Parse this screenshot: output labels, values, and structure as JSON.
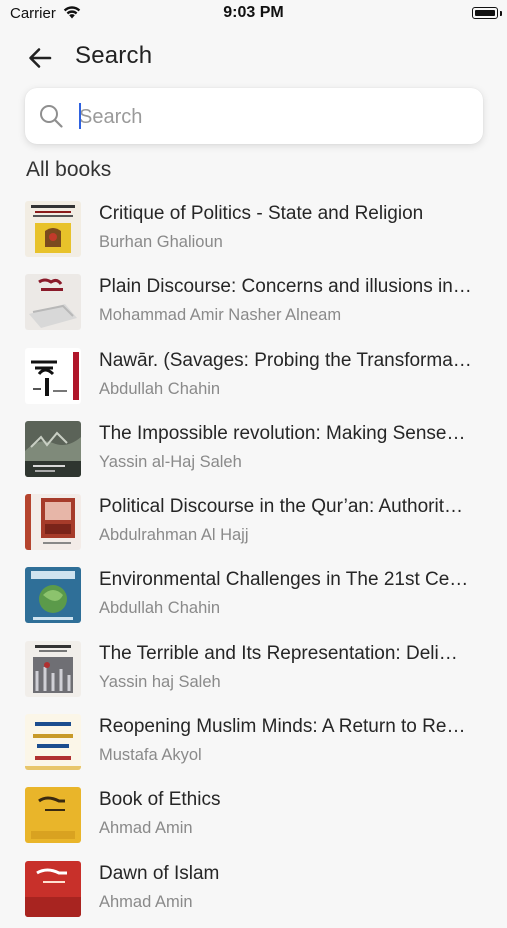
{
  "status_bar": {
    "carrier": "Carrier",
    "time": "9:03 PM"
  },
  "header": {
    "title": "Search"
  },
  "search": {
    "placeholder": "Search",
    "value": ""
  },
  "section": {
    "title": "All books"
  },
  "books": [
    {
      "title": "Critique of Politics - State and Religion",
      "author": "Burhan Ghalioun"
    },
    {
      "title": "Plain Discourse: Concerns and illusions in…",
      "author": "Mohammad Amir Nasher Alneam"
    },
    {
      "title": "Nawār. (Savages: Probing the Transforma…",
      "author": "Abdullah Chahin"
    },
    {
      "title": "The Impossible revolution: Making Sense…",
      "author": "Yassin al-Haj Saleh"
    },
    {
      "title": "Political Discourse in the Qur’an: Authorit…",
      "author": "Abdulrahman Al Hajj"
    },
    {
      "title": "Environmental Challenges in The 21st Ce…",
      "author": "Abdullah Chahin"
    },
    {
      "title": "The Terrible and Its Representation: Deli…",
      "author": "Yassin haj Saleh"
    },
    {
      "title": "Reopening Muslim Minds: A Return to Re…",
      "author": "Mustafa Akyol"
    },
    {
      "title": "Book of Ethics",
      "author": "Ahmad Amin"
    },
    {
      "title": "Dawn of Islam",
      "author": "Ahmad Amin"
    }
  ],
  "icons": {
    "back": "arrow-left-icon",
    "search": "magnifier-icon",
    "wifi": "wifi-icon",
    "battery": "battery-icon"
  }
}
